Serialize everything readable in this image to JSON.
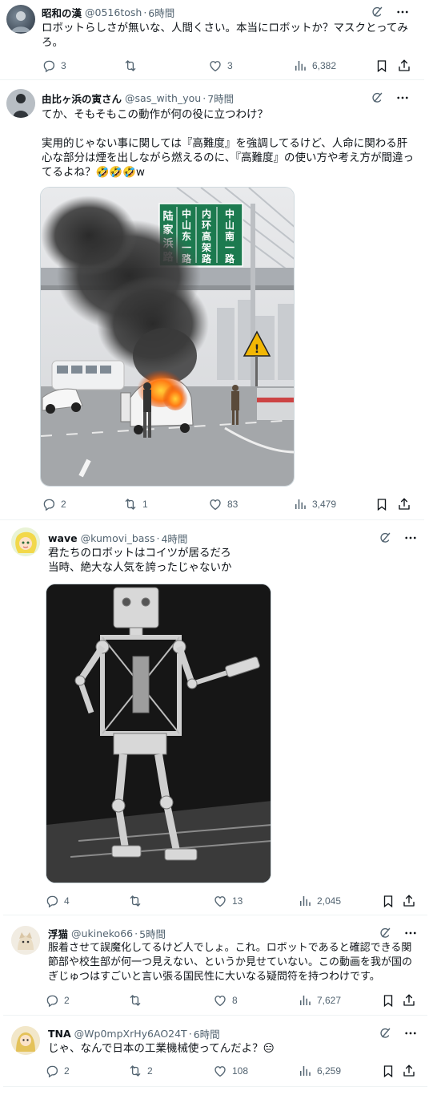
{
  "posts": [
    {
      "name": "昭和の漢",
      "handle": "@0516tosh",
      "time": "6時間",
      "text": "ロボットらしさが無いな、人間くさい。本当にロボットか？マスクとってみろ。",
      "replies": "3",
      "reposts": "",
      "likes": "3",
      "views": "6,382"
    },
    {
      "name": "由比ヶ浜の寅さん",
      "handle": "@sas_with_you",
      "time": "7時間",
      "text": "てか、そもそもこの動作が何の役に立つわけ？\n\n実用的じゃない事に関しては『高難度』を強調してるけど、人命に関わる肝心な部分は煙を出しながら燃えるのに、『高難度』の使い方や考え方が間違ってるよね？🤣🤣🤣w",
      "replies": "2",
      "reposts": "1",
      "likes": "83",
      "views": "3,479",
      "sign": {
        "col1": [
          "陆",
          "家",
          "浜",
          "路"
        ],
        "col2": [
          "中",
          "山",
          "东",
          "一",
          "路"
        ],
        "col3": [
          "内",
          "环",
          "高",
          "架",
          "路"
        ],
        "col4": [
          "中",
          "山",
          "南",
          "一",
          "路"
        ]
      }
    },
    {
      "name": "wave",
      "handle": "@kumovi_bass",
      "time": "4時間",
      "text": "君たちのロボットはコイツが居るだろ\n当時、絶大な人気を誇ったじゃないか",
      "replies": "4",
      "reposts": "",
      "likes": "13",
      "views": "2,045"
    },
    {
      "name": "浮猫",
      "handle": "@ukineko66",
      "time": "5時間",
      "text": "服着させて誤魔化してるけど人でしょ。これ。ロボットであると確認できる関節部や校生部が何一つ見えない、というか見せていない。この動画を我が国のぎじゅつはすごいと言い張る国民性に大いなる疑問符を持つわけです。",
      "replies": "2",
      "reposts": "",
      "likes": "8",
      "views": "7,627"
    },
    {
      "name": "TNA",
      "handle": "@Wp0mpXrHy6AO24T",
      "time": "6時間",
      "text": "じゃ、なんで日本の工業機械使ってんだよ？😑",
      "replies": "2",
      "reposts": "2",
      "likes": "108",
      "views": "6,259"
    }
  ],
  "colors": {
    "text": "#0f1419",
    "muted": "#536471",
    "border": "#eff3f4",
    "sign": "#1c7a4f"
  },
  "icons": [
    "grok-icon",
    "more-icon",
    "reply-icon",
    "repost-icon",
    "like-icon",
    "views-icon",
    "bookmark-icon",
    "share-icon"
  ]
}
